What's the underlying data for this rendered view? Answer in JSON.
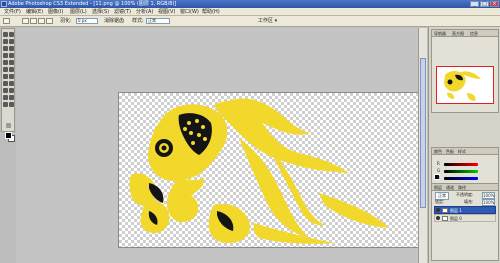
{
  "window": {
    "title": "Adobe Photoshop CS3 Extended - [11.png @ 100% (图层 1, RGB/8)]",
    "controls": [
      "_",
      "□",
      "×"
    ]
  },
  "menu": [
    "文件(F)",
    "编辑(E)",
    "图像(I)",
    "图层(L)",
    "选择(S)",
    "滤镜(T)",
    "分析(A)",
    "视图(V)",
    "窗口(W)",
    "帮助(H)"
  ],
  "options_bar": {
    "label1": "羽化:",
    "field1": "0 px",
    "label2": "消除锯齿",
    "label3": "样式:",
    "style_value": "正常",
    "workspace": "工作区 ▾"
  },
  "panels": {
    "navigator_tabs": [
      "导航器",
      "直方图",
      "信息"
    ],
    "color_tabs": [
      "颜色",
      "色板",
      "样式"
    ],
    "color_labels": [
      "R",
      "G",
      "B"
    ],
    "layers_tabs": [
      "图层",
      "通道",
      "路径"
    ],
    "blend_mode": "正常",
    "opacity_label": "不透明度:",
    "opacity_value": "100%",
    "lock_label": "锁定:",
    "fill_label": "填充:",
    "fill_value": "100%",
    "layers": [
      {
        "name": "图层 1",
        "selected": true
      },
      {
        "name": "图层 0",
        "selected": false
      }
    ]
  },
  "colors": {
    "fish_yellow": "#f2d82b",
    "fish_dark": "#141414",
    "title_blue": "#2d56a8"
  }
}
